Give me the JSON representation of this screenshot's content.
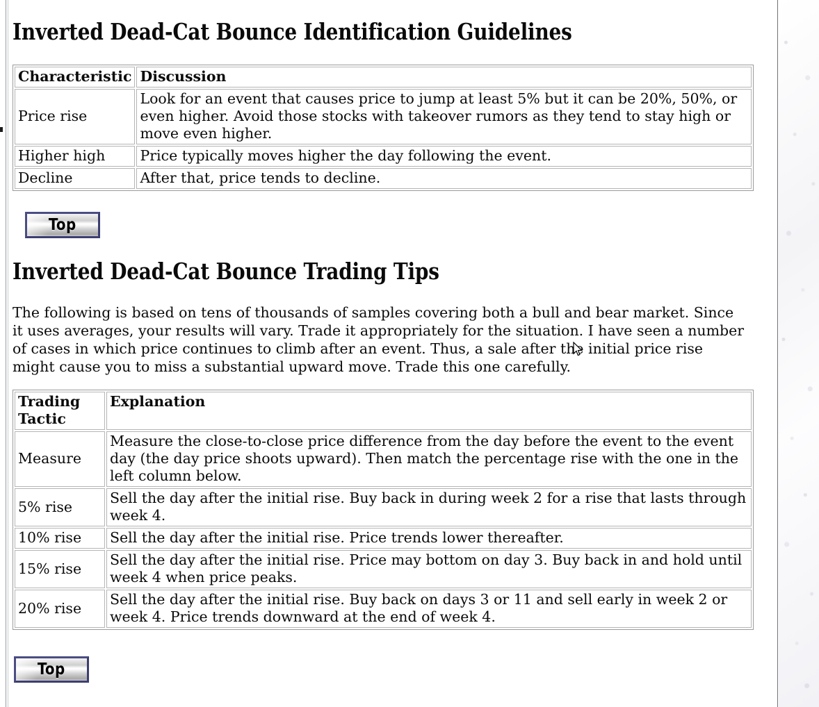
{
  "page": {
    "title_1": "Inverted Dead-Cat Bounce Identification Guidelines",
    "title_2": "Inverted Dead-Cat Bounce Trading Tips",
    "intro_paragraph": "The following is based on tens of thousands of samples covering both a bull and bear market. Since it uses averages, your results will vary. Trade it appropriately for the situation. I have seen a number of cases in which price continues to climb after an event. Thus, a sale after the initial price rise might cause you to miss a substantial upward move. Trade this one carefully."
  },
  "identification_table": {
    "headers": [
      "Characteristic",
      "Discussion"
    ],
    "rows": [
      {
        "characteristic": "Price rise",
        "discussion": "Look for an event that causes price to jump at least 5% but it can be 20%, 50%, or even higher. Avoid those stocks with takeover rumors as they tend to stay high or move even higher."
      },
      {
        "characteristic": "Higher high",
        "discussion": "Price typically moves higher the day following the event."
      },
      {
        "characteristic": "Decline",
        "discussion": "After that, price tends to decline."
      }
    ]
  },
  "trading_tips_table": {
    "headers": [
      "Trading Tactic",
      "Explanation"
    ],
    "rows": [
      {
        "tactic": "Measure",
        "explanation": "Measure the close-to-close price difference from the day before the event to the event day (the day price shoots upward). Then match the percentage rise with the one in the left column below."
      },
      {
        "tactic": "5% rise",
        "explanation": "Sell the day after the initial rise. Buy back in during week 2 for a rise that lasts through week 4."
      },
      {
        "tactic": "10% rise",
        "explanation": "Sell the day after the initial rise. Price trends lower thereafter."
      },
      {
        "tactic": "15% rise",
        "explanation": "Sell the day after the initial rise. Price may bottom on day 3. Buy back in and hold until week 4 when price peaks."
      },
      {
        "tactic": "20% rise",
        "explanation": "Sell the day after the initial rise. Buy back on days 3 or 11 and sell early in week 2 or week 4. Price trends downward at the end of week 4."
      }
    ]
  },
  "buttons": {
    "top_label_1": "Top",
    "top_label_2": "Top"
  },
  "colors": {
    "text": "#0b0b0b",
    "table_border": "#b5b5b5",
    "table_outer_border": "#9a9a9a",
    "button_border": "#4b4d84",
    "page_background": "#ffffff"
  },
  "icons": {
    "cursor": "arrow-pointer-cursor"
  }
}
